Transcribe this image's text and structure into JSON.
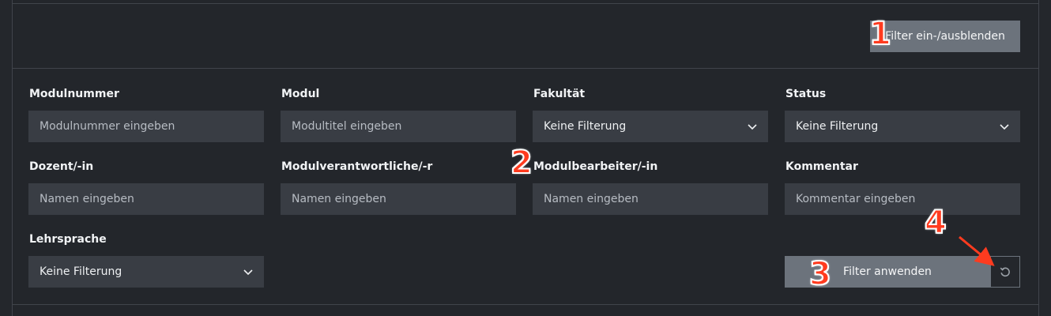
{
  "toolbar": {
    "toggle_label": "Filter ein-/ausblenden"
  },
  "filters": {
    "modulnummer": {
      "label": "Modulnummer",
      "placeholder": "Modulnummer eingeben"
    },
    "modul": {
      "label": "Modul",
      "placeholder": "Modultitel eingeben"
    },
    "fakultaet": {
      "label": "Fakultät",
      "value": "Keine Filterung"
    },
    "status": {
      "label": "Status",
      "value": "Keine Filterung"
    },
    "dozent": {
      "label": "Dozent/-in",
      "placeholder": "Namen eingeben"
    },
    "verantwortliche": {
      "label": "Modulverantwortliche/-r",
      "placeholder": "Namen eingeben"
    },
    "bearbeiter": {
      "label": "Modulbearbeiter/-in",
      "placeholder": "Namen eingeben"
    },
    "kommentar": {
      "label": "Kommentar",
      "placeholder": "Kommentar eingeben"
    },
    "lehrsprache": {
      "label": "Lehrsprache",
      "value": "Keine Filterung"
    }
  },
  "actions": {
    "apply_label": "Filter anwenden",
    "reset_icon": "reset-icon"
  },
  "annotations": {
    "a1": "1",
    "a2": "2",
    "a3": "3",
    "a4": "4",
    "color": "#ff3b1f"
  }
}
